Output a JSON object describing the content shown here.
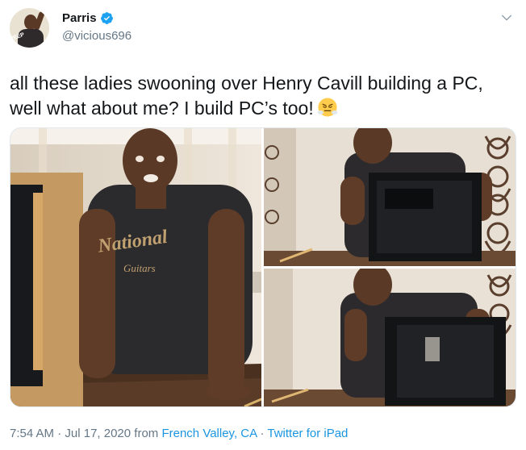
{
  "author": {
    "display_name": "Parris",
    "handle": "@vicious696",
    "verified": true,
    "avatar_badge": "WEEP"
  },
  "tweet": {
    "text": "all these ladies swooning over Henry Cavill building a PC, well what about me? I build PC’s too!",
    "emoji": "face-with-steam-emoji"
  },
  "media": {
    "count": 3,
    "shirt_text": "National",
    "shirt_text_small": "Guitars"
  },
  "meta": {
    "time": "7:54 AM",
    "separator1": " · ",
    "date": "Jul 17, 2020",
    "from_word": " from ",
    "location": "French Valley, CA",
    "separator2": " · ",
    "source": "Twitter for iPad"
  },
  "colors": {
    "text": "#14171a",
    "secondary": "#657786",
    "link": "#1b95e0",
    "verified": "#1da1f2"
  },
  "icons": {
    "verified": "verified-badge-icon",
    "more": "chevron-down-icon"
  }
}
